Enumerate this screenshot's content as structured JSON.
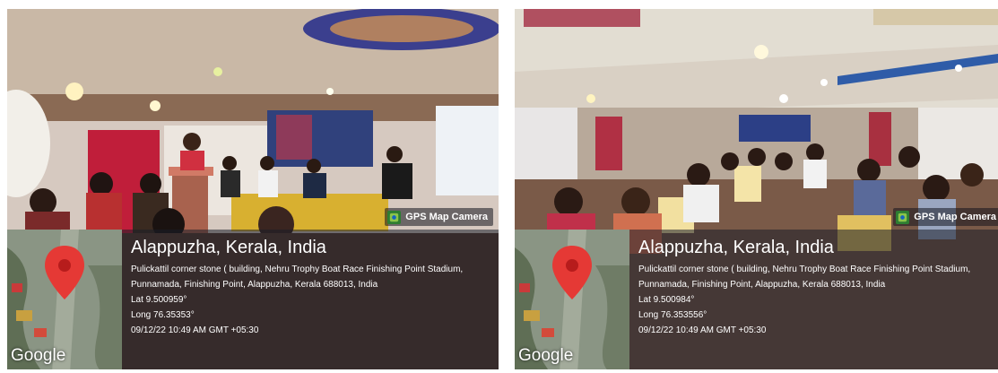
{
  "photos": [
    {
      "badge": "GPS Map Camera",
      "map_brand": "Google",
      "place": "Alappuzha, Kerala, India",
      "address": "Pulickattil corner stone ( building, Nehru Trophy Boat Race Finishing Point Stadium, Punnamada, Finishing Point, Alappuzha, Kerala 688013, India",
      "lat": "Lat 9.500959°",
      "long": "Long 76.35353°",
      "datetime": "09/12/22 10:49 AM GMT +05:30"
    },
    {
      "badge": "GPS Map Camera",
      "map_brand": "Google",
      "place": "Alappuzha, Kerala, India",
      "address": "Pulickattil corner stone ( building, Nehru Trophy Boat Race Finishing Point Stadium, Punnamada, Finishing Point, Alappuzha, Kerala 688013, India",
      "lat": "Lat 9.500984°",
      "long": "Long 76.353556°",
      "datetime": "09/12/22 10:49 AM GMT +05:30"
    }
  ],
  "colors": {
    "pin": "#e53935",
    "overlay": "#1e2430"
  }
}
